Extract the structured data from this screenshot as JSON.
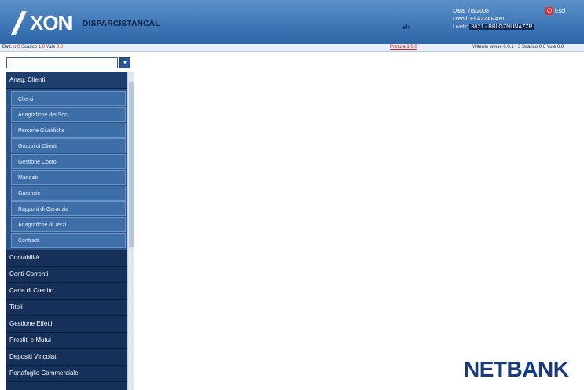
{
  "header": {
    "logo_text": "XON",
    "logo_sub": "",
    "company": "DISPARCISTANCAL",
    "mark": "ah",
    "info": {
      "line1": "Data: 7/5/2008",
      "line2": "Utenti: ELAZZARANI",
      "line3_label": "Livelli:",
      "line3_value": "8821 - BBLOZNUNAZZR"
    },
    "exit_label": "Esci"
  },
  "statusbar": {
    "left_prefix": "Batt.",
    "left_a": "u.0",
    "left_mid": " Scarico ",
    "left_b": "1.0",
    "left_suffix": " Yale",
    "left_c": "0.0",
    "middle": "Pretura 1.0.0",
    "right": "Mittente wmse 0.0.1 - 3 Scarico 0.0 Yule 0.0"
  },
  "search": {
    "value": "",
    "button_icon": "arrow-down-icon"
  },
  "sidebar": {
    "active_section": "Anag. Clienti",
    "sub_items": [
      "Clienti",
      "Anagrafiche dei Soci",
      "Persone Giuridiche",
      "Gruppi di Clienti",
      "Gestione Conto",
      "Mandati",
      "Garanzie",
      "Rapporti di Garanzia",
      "Anagrafiche di Terzi",
      "Contratti"
    ],
    "sections": [
      "Contabilità",
      "Conti Correnti",
      "Carte di Credito",
      "Titoli",
      "Gestione Effetti",
      "Prestiti e Mutui",
      "Depositi Vincolati",
      "Portafoglio Commerciale"
    ]
  },
  "footer": {
    "brand_prefix": "NETB",
    "brand_mid": "A",
    "brand_suffix": "NK"
  }
}
